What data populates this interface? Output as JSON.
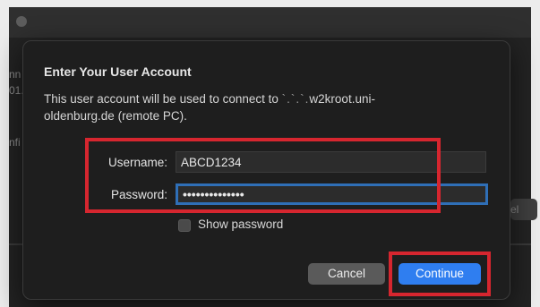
{
  "background": {
    "text_fragments": [
      "nn",
      "01.",
      "nfi"
    ],
    "button_fragment": "el"
  },
  "dialog": {
    "title": "Enter Your User Account",
    "description_prefix": "This user account will be used to connect to",
    "description_host_obscured": " `.`.`.",
    "description_host_visible": "w2kroot.uni-",
    "description_line2": "oldenburg.de (remote PC).",
    "username_label": "Username:",
    "username_value": "ABCD1234",
    "password_label": "Password:",
    "password_mask": "••••••••••••••",
    "show_password_label": "Show password",
    "cancel_label": "Cancel",
    "continue_label": "Continue"
  },
  "colors": {
    "highlight": "#d6262f",
    "accent": "#2f7ef0",
    "focus_ring": "#2f6fb7"
  }
}
